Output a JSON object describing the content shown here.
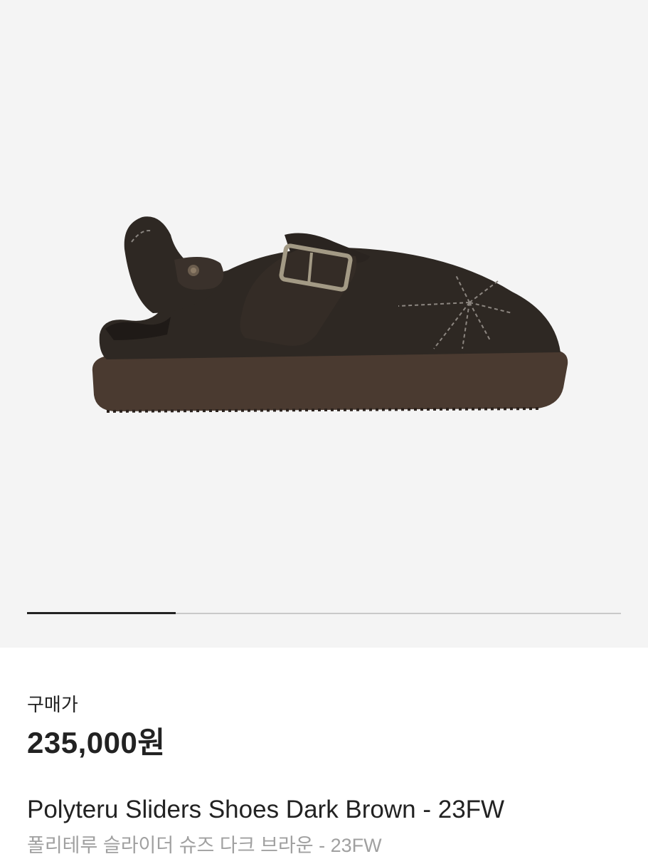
{
  "gallery": {
    "image_icon": "shoe-product-photo",
    "slide_progress": 0.25
  },
  "product": {
    "price_label": "구매가",
    "price": "235,000원",
    "name_en": "Polyteru Sliders Shoes Dark Brown - 23FW",
    "name_ko": "폴리테루 슬라이더 슈즈 다크 브라운 - 23FW"
  },
  "colors": {
    "gallery_bg": "#f4f4f4",
    "text_primary": "#222222",
    "text_secondary": "#a0a0a0",
    "shoe_suede": "#2e2823",
    "shoe_sole": "#4a3a30"
  }
}
